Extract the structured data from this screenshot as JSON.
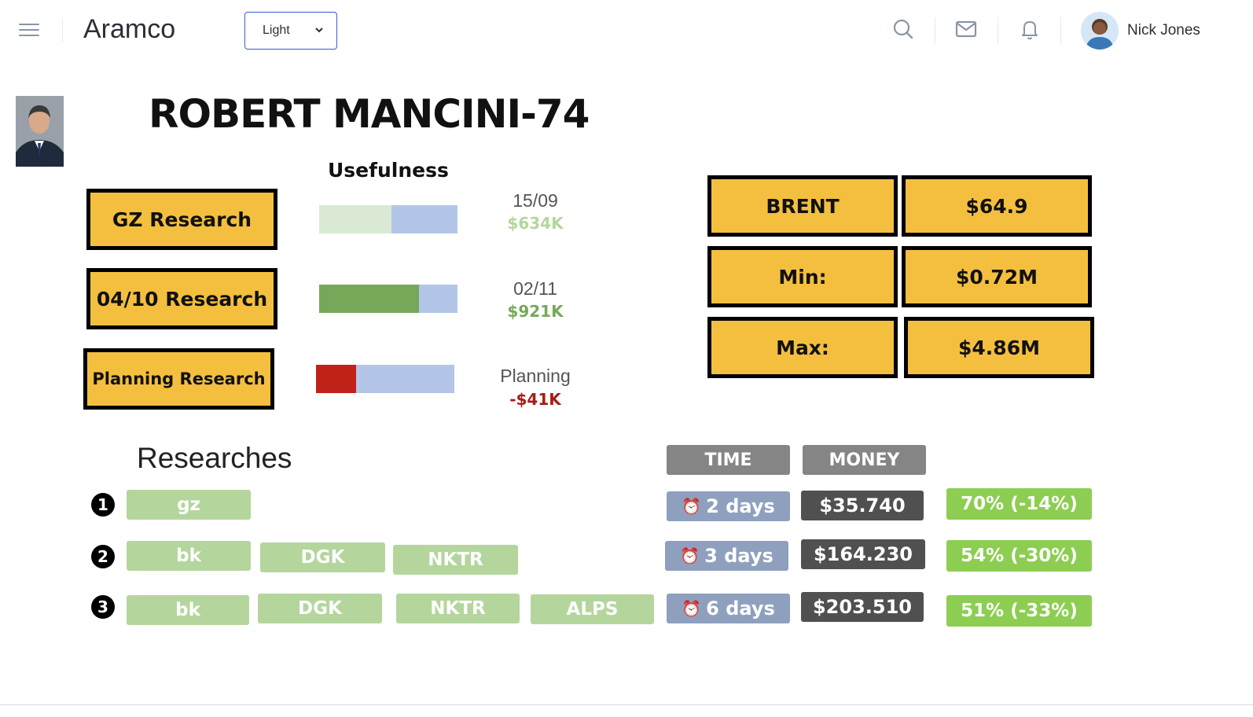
{
  "header": {
    "app_title": "Aramco",
    "theme_select": {
      "value": "Light"
    },
    "user": {
      "name": "Nick Jones"
    },
    "icons": [
      "menu-icon",
      "search-icon",
      "mail-icon",
      "bell-icon",
      "chevron-down-icon"
    ]
  },
  "profile": {
    "name": "ROBERT MANCINI-74",
    "usefulness_title": "Usefulness"
  },
  "research_items": [
    {
      "label": "GZ Research",
      "date": "15/09",
      "amount": "$634K",
      "fill": 0.52,
      "fill_color": "#dae9d4",
      "rest_color": "#b4c6e7",
      "amount_color": "#b4d69d"
    },
    {
      "label": "04/10 Research",
      "date": "02/11",
      "amount": "$921K",
      "fill": 0.72,
      "fill_color": "#77a85a",
      "rest_color": "#b4c6e7",
      "amount_color": "#77a85a"
    },
    {
      "label": "Planning Research",
      "date": "Planning",
      "amount": "-$41K",
      "fill": 0.29,
      "fill_color": "#c0221a",
      "rest_color": "#b4c6e7",
      "amount_color": "#a51d14"
    }
  ],
  "stats": [
    {
      "label": "BRENT",
      "value": "$64.9"
    },
    {
      "label": "Min:",
      "value": "$0.72M"
    },
    {
      "label": "Max:",
      "value": "$4.86M"
    }
  ],
  "researches": {
    "title": "Researches",
    "col_time": "TIME",
    "col_money": "MONEY",
    "rows": [
      {
        "num": "1",
        "tags": [
          "gz"
        ],
        "time": "2 days",
        "money": "$35.740",
        "pct": "70% (-14%)"
      },
      {
        "num": "2",
        "tags": [
          "bk",
          "DGK",
          "NKTR"
        ],
        "time": "3 days",
        "money": "$164.230",
        "pct": "54% (-30%)"
      },
      {
        "num": "3",
        "tags": [
          "bk",
          "DGK",
          "NKTR",
          "ALPS"
        ],
        "time": "6 days",
        "money": "$203.510",
        "pct": "51% (-33%)"
      }
    ],
    "time_icon": "alarm-clock-icon"
  },
  "colors": {
    "button_fill": "#f4bf3f",
    "tag_green": "#b4d69d",
    "time_blue": "#8fa0bf",
    "money_gray": "#505050",
    "pct_green": "#8dce52",
    "header_gray": "#858585",
    "accent_border": "#3a5bd0"
  }
}
